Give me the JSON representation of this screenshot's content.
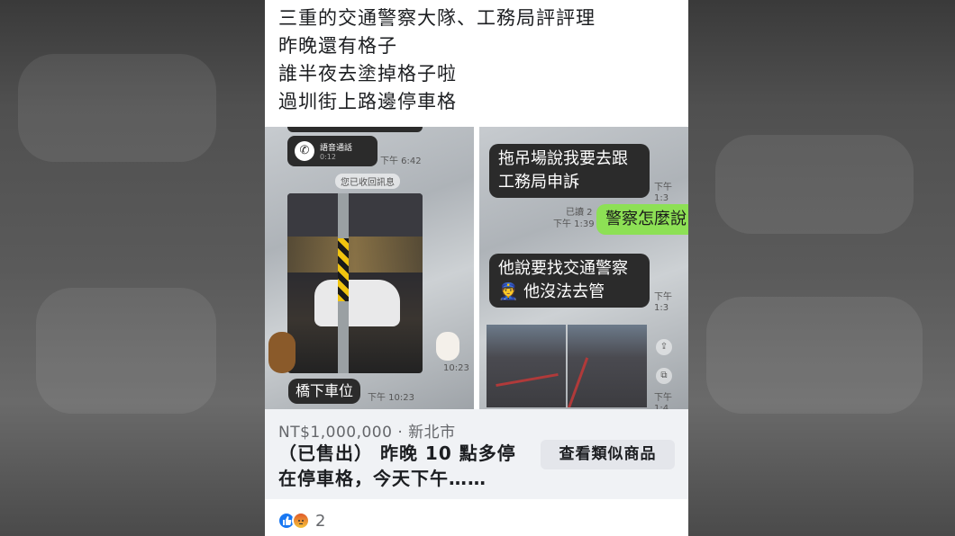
{
  "post": {
    "text_lines": [
      "三重的交通警察大隊、工務局評評理",
      "昨晚還有格子",
      "誰半夜去塗掉格子啦",
      "過圳街上路邊停車格"
    ]
  },
  "left_screenshot": {
    "call_label": "語音通話",
    "call_duration": "0:12",
    "call_time": "下午 6:42",
    "recall_notice": "您已收回訊息",
    "photo_time": "10:23",
    "caption_bubble": "橋下車位",
    "caption_time": "下午 10:23"
  },
  "right_screenshot": {
    "bubble_1": "拖吊場說我要去跟\n工務局申訴",
    "bubble_1_time": "下午 1:3",
    "read_status": "已讀 2",
    "sent_time": "下午 1:39",
    "bubble_green": "警察怎麼說",
    "bubble_2": "他說要找交通警察\n👮 他沒法去管",
    "bubble_2_time": "下午 1:3",
    "photo_time": "下午 1:4"
  },
  "listing": {
    "price_location": "NT$1,000,000 · 新北市",
    "title_line_1": "（已售出） 昨晚 10 點多停",
    "title_line_2": "在停車格，今天下午……",
    "view_similar_button": "查看類似商品"
  },
  "reactions": {
    "icons": [
      "like-icon",
      "angry-icon"
    ],
    "count": "2",
    "colors": {
      "like": "#1877f2",
      "angry": "#f5793a"
    }
  }
}
